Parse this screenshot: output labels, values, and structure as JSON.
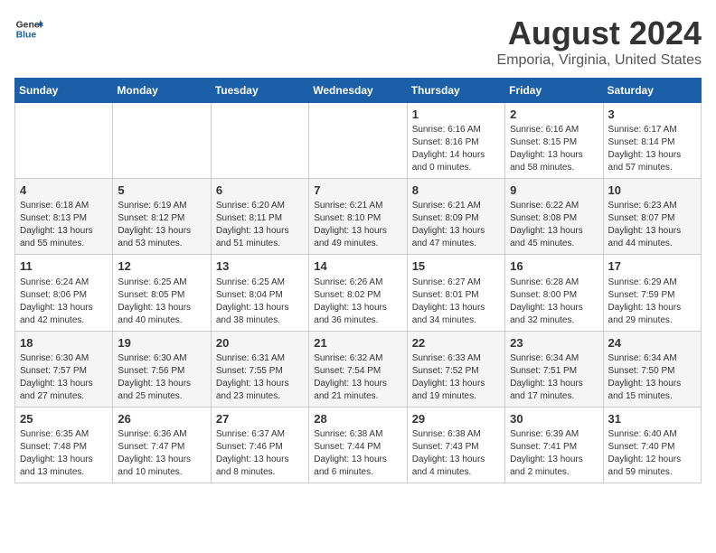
{
  "header": {
    "logo_general": "General",
    "logo_blue": "Blue",
    "month_year": "August 2024",
    "location": "Emporia, Virginia, United States"
  },
  "weekdays": [
    "Sunday",
    "Monday",
    "Tuesday",
    "Wednesday",
    "Thursday",
    "Friday",
    "Saturday"
  ],
  "weeks": [
    [
      {
        "day": "",
        "info": ""
      },
      {
        "day": "",
        "info": ""
      },
      {
        "day": "",
        "info": ""
      },
      {
        "day": "",
        "info": ""
      },
      {
        "day": "1",
        "info": "Sunrise: 6:16 AM\nSunset: 8:16 PM\nDaylight: 14 hours\nand 0 minutes."
      },
      {
        "day": "2",
        "info": "Sunrise: 6:16 AM\nSunset: 8:15 PM\nDaylight: 13 hours\nand 58 minutes."
      },
      {
        "day": "3",
        "info": "Sunrise: 6:17 AM\nSunset: 8:14 PM\nDaylight: 13 hours\nand 57 minutes."
      }
    ],
    [
      {
        "day": "4",
        "info": "Sunrise: 6:18 AM\nSunset: 8:13 PM\nDaylight: 13 hours\nand 55 minutes."
      },
      {
        "day": "5",
        "info": "Sunrise: 6:19 AM\nSunset: 8:12 PM\nDaylight: 13 hours\nand 53 minutes."
      },
      {
        "day": "6",
        "info": "Sunrise: 6:20 AM\nSunset: 8:11 PM\nDaylight: 13 hours\nand 51 minutes."
      },
      {
        "day": "7",
        "info": "Sunrise: 6:21 AM\nSunset: 8:10 PM\nDaylight: 13 hours\nand 49 minutes."
      },
      {
        "day": "8",
        "info": "Sunrise: 6:21 AM\nSunset: 8:09 PM\nDaylight: 13 hours\nand 47 minutes."
      },
      {
        "day": "9",
        "info": "Sunrise: 6:22 AM\nSunset: 8:08 PM\nDaylight: 13 hours\nand 45 minutes."
      },
      {
        "day": "10",
        "info": "Sunrise: 6:23 AM\nSunset: 8:07 PM\nDaylight: 13 hours\nand 44 minutes."
      }
    ],
    [
      {
        "day": "11",
        "info": "Sunrise: 6:24 AM\nSunset: 8:06 PM\nDaylight: 13 hours\nand 42 minutes."
      },
      {
        "day": "12",
        "info": "Sunrise: 6:25 AM\nSunset: 8:05 PM\nDaylight: 13 hours\nand 40 minutes."
      },
      {
        "day": "13",
        "info": "Sunrise: 6:25 AM\nSunset: 8:04 PM\nDaylight: 13 hours\nand 38 minutes."
      },
      {
        "day": "14",
        "info": "Sunrise: 6:26 AM\nSunset: 8:02 PM\nDaylight: 13 hours\nand 36 minutes."
      },
      {
        "day": "15",
        "info": "Sunrise: 6:27 AM\nSunset: 8:01 PM\nDaylight: 13 hours\nand 34 minutes."
      },
      {
        "day": "16",
        "info": "Sunrise: 6:28 AM\nSunset: 8:00 PM\nDaylight: 13 hours\nand 32 minutes."
      },
      {
        "day": "17",
        "info": "Sunrise: 6:29 AM\nSunset: 7:59 PM\nDaylight: 13 hours\nand 29 minutes."
      }
    ],
    [
      {
        "day": "18",
        "info": "Sunrise: 6:30 AM\nSunset: 7:57 PM\nDaylight: 13 hours\nand 27 minutes."
      },
      {
        "day": "19",
        "info": "Sunrise: 6:30 AM\nSunset: 7:56 PM\nDaylight: 13 hours\nand 25 minutes."
      },
      {
        "day": "20",
        "info": "Sunrise: 6:31 AM\nSunset: 7:55 PM\nDaylight: 13 hours\nand 23 minutes."
      },
      {
        "day": "21",
        "info": "Sunrise: 6:32 AM\nSunset: 7:54 PM\nDaylight: 13 hours\nand 21 minutes."
      },
      {
        "day": "22",
        "info": "Sunrise: 6:33 AM\nSunset: 7:52 PM\nDaylight: 13 hours\nand 19 minutes."
      },
      {
        "day": "23",
        "info": "Sunrise: 6:34 AM\nSunset: 7:51 PM\nDaylight: 13 hours\nand 17 minutes."
      },
      {
        "day": "24",
        "info": "Sunrise: 6:34 AM\nSunset: 7:50 PM\nDaylight: 13 hours\nand 15 minutes."
      }
    ],
    [
      {
        "day": "25",
        "info": "Sunrise: 6:35 AM\nSunset: 7:48 PM\nDaylight: 13 hours\nand 13 minutes."
      },
      {
        "day": "26",
        "info": "Sunrise: 6:36 AM\nSunset: 7:47 PM\nDaylight: 13 hours\nand 10 minutes."
      },
      {
        "day": "27",
        "info": "Sunrise: 6:37 AM\nSunset: 7:46 PM\nDaylight: 13 hours\nand 8 minutes."
      },
      {
        "day": "28",
        "info": "Sunrise: 6:38 AM\nSunset: 7:44 PM\nDaylight: 13 hours\nand 6 minutes."
      },
      {
        "day": "29",
        "info": "Sunrise: 6:38 AM\nSunset: 7:43 PM\nDaylight: 13 hours\nand 4 minutes."
      },
      {
        "day": "30",
        "info": "Sunrise: 6:39 AM\nSunset: 7:41 PM\nDaylight: 13 hours\nand 2 minutes."
      },
      {
        "day": "31",
        "info": "Sunrise: 6:40 AM\nSunset: 7:40 PM\nDaylight: 12 hours\nand 59 minutes."
      }
    ]
  ]
}
